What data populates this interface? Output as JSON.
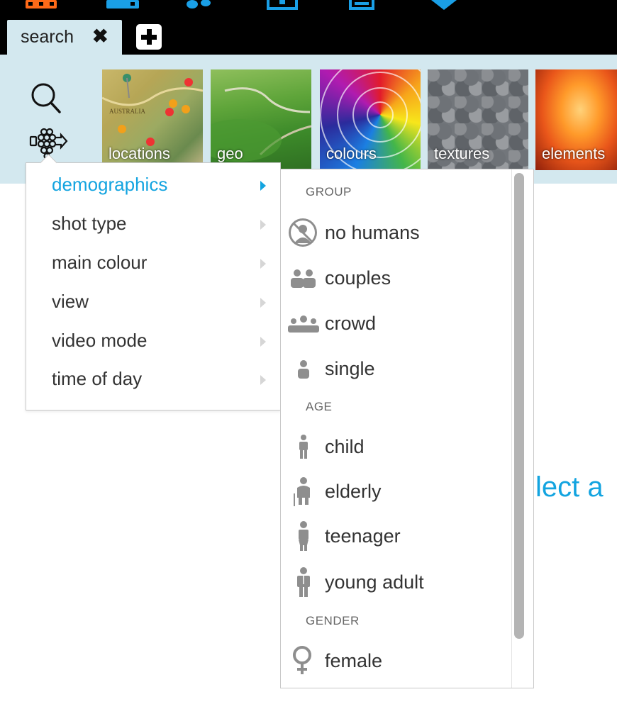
{
  "toolbar": {
    "icons": [
      "film-icon",
      "tv-icon",
      "music-icon",
      "download-box-icon",
      "document-icon",
      "chevron-down-icon"
    ],
    "colors": {
      "film": "#ff6a18",
      "accent": "#1a9fe6",
      "background": "#000000"
    }
  },
  "tabs": [
    {
      "label": "search",
      "close": "✖"
    }
  ],
  "search_strip": {
    "categories": [
      {
        "label": "locations"
      },
      {
        "label": "geo"
      },
      {
        "label": "colours"
      },
      {
        "label": "textures"
      },
      {
        "label": "elements"
      }
    ]
  },
  "filter_menu": {
    "items": [
      {
        "label": "demographics",
        "active": true
      },
      {
        "label": "shot type"
      },
      {
        "label": "main colour"
      },
      {
        "label": "view"
      },
      {
        "label": "video mode"
      },
      {
        "label": "time of day"
      }
    ]
  },
  "submenu": {
    "groups": [
      {
        "heading": "GROUP",
        "items": [
          {
            "label": "no humans",
            "icon": "no-humans-icon"
          },
          {
            "label": "couples",
            "icon": "couples-icon"
          },
          {
            "label": "crowd",
            "icon": "crowd-icon"
          },
          {
            "label": "single",
            "icon": "single-person-icon"
          }
        ]
      },
      {
        "heading": "AGE",
        "items": [
          {
            "label": "child",
            "icon": "child-icon"
          },
          {
            "label": "elderly",
            "icon": "elderly-icon"
          },
          {
            "label": "teenager",
            "icon": "teenager-icon"
          },
          {
            "label": "young adult",
            "icon": "young-adult-icon"
          }
        ]
      },
      {
        "heading": "GENDER",
        "items": [
          {
            "label": "female",
            "icon": "female-icon"
          }
        ]
      }
    ]
  },
  "main": {
    "partial_text": "lect a"
  },
  "colors": {
    "accent": "#13a4e0",
    "strip": "#d3e8ef",
    "icon_gray": "#8e8e8e"
  }
}
